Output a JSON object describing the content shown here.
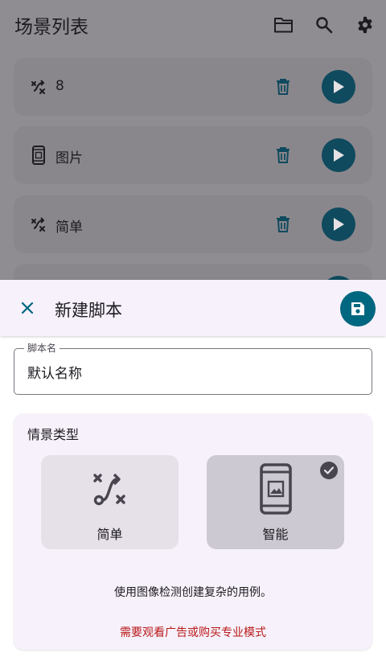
{
  "app_bar": {
    "title": "场景列表",
    "icons": [
      "folder-icon",
      "search-icon",
      "gear-icon"
    ]
  },
  "scenes": [
    {
      "label": "8",
      "icon": "shuffle-icon"
    },
    {
      "label": "图片",
      "icon": "phone-image-icon"
    },
    {
      "label": "简单",
      "icon": "shuffle-icon"
    }
  ],
  "sheet": {
    "title": "新建脚本",
    "close_icon": "close-icon",
    "save_icon": "save-icon",
    "name_field": {
      "label": "脚本名",
      "value": "默认名称"
    },
    "scene_type": {
      "title": "情景类型",
      "options": [
        {
          "label": "简单",
          "icon": "route-icon",
          "selected": false
        },
        {
          "label": "智能",
          "icon": "phone-image-icon",
          "selected": true
        }
      ],
      "description": "使用图像检测创建复杂的用例。",
      "warning": "需要观看广告或购买专业模式"
    }
  },
  "colors": {
    "accent": "#006780",
    "play_button": "#0f4a5e",
    "warning": "#ba1a1a",
    "scrim": "#8f8d92"
  }
}
